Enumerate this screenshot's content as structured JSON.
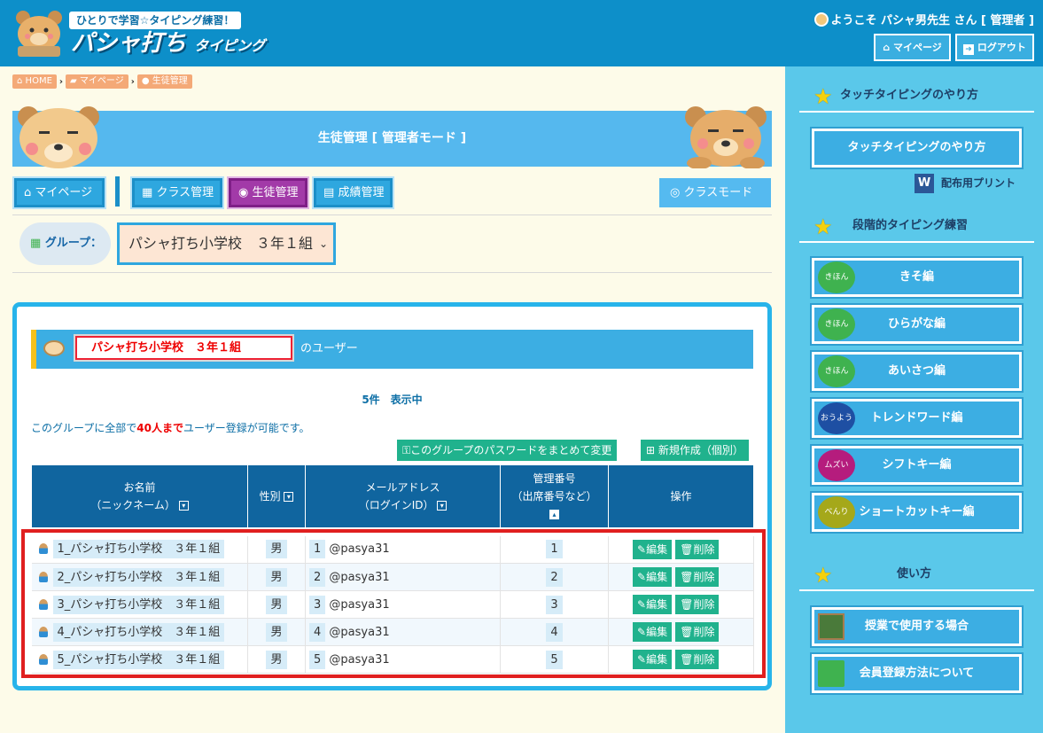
{
  "header": {
    "logo_sub": "ひとりで学習☆タイピング練習！",
    "logo_main": "パシャ打ち",
    "logo_main_small": "タイピング",
    "welcome": "ようこそ パシャ男先生 さん [ 管理者 ]",
    "mypage_label": "マイページ",
    "logout_label": "ログアウト"
  },
  "breadcrumb": {
    "home": "HOME",
    "mypage": "マイページ",
    "current": "生徒管理"
  },
  "banner": {
    "title": "生徒管理 [ 管理者モード ]"
  },
  "nav": {
    "mypage": "マイページ",
    "class": "クラス管理",
    "student": "生徒管理",
    "grades": "成績管理",
    "class_mode": "クラスモード"
  },
  "group": {
    "label": "グループ：",
    "selected": "パシャ打ち小学校　３年１組"
  },
  "panel": {
    "group_name": "パシャ打ち小学校　３年１組",
    "suffix": "のユーザー",
    "count": "5件　表示中",
    "limit_prefix": "このグループに全部で",
    "limit_emph": "40人まで",
    "limit_suffix": "ユーザー登録が可能です。",
    "btn_password": "このグループのパスワードをまとめて変更",
    "btn_new": "新規作成（個別）"
  },
  "table": {
    "col_name_1": "お名前",
    "col_name_2": "（ニックネーム）",
    "col_gender": "性別",
    "col_email_1": "メールアドレス",
    "col_email_2": "（ログインID）",
    "col_num_1": "管理番号",
    "col_num_2": "（出席番号など）",
    "col_op": "操作",
    "edit_label": "編集",
    "delete_label": "削除",
    "rows": [
      {
        "name": "1_パシャ打ち小学校　３年１組",
        "gender": "男",
        "id": "1",
        "email": "@pasya31",
        "num": "1"
      },
      {
        "name": "2_パシャ打ち小学校　３年１組",
        "gender": "男",
        "id": "2",
        "email": "@pasya31",
        "num": "2"
      },
      {
        "name": "3_パシャ打ち小学校　３年１組",
        "gender": "男",
        "id": "3",
        "email": "@pasya31",
        "num": "3"
      },
      {
        "name": "4_パシャ打ち小学校　３年１組",
        "gender": "男",
        "id": "4",
        "email": "@pasya31",
        "num": "4"
      },
      {
        "name": "5_パシャ打ち小学校　３年１組",
        "gender": "男",
        "id": "5",
        "email": "@pasya31",
        "num": "5"
      }
    ]
  },
  "sidebar": {
    "sec1": "タッチタイピングのやり方",
    "touch_btn": "タッチタイピングのやり方",
    "print": "配布用プリント",
    "sec2": "段階的タイピング練習",
    "courses": [
      {
        "badge": "きほん",
        "label": "きそ編",
        "color": "#3fb24f"
      },
      {
        "badge": "きほん",
        "label": "ひらがな編",
        "color": "#3fb24f"
      },
      {
        "badge": "きほん",
        "label": "あいさつ編",
        "color": "#3fb24f"
      },
      {
        "badge": "おうよう",
        "label": "トレンドワード編",
        "color": "#1e4fa3"
      },
      {
        "badge": "ムズい",
        "label": "シフトキー編",
        "color": "#b51c7d"
      },
      {
        "badge": "べんり",
        "label": "ショートカットキー編",
        "color": "#a5a81a"
      }
    ],
    "sec3": "使い方",
    "use1": "授業で使用する場合",
    "use2": "会員登録方法について"
  },
  "colors": {
    "header": "#0d8fc9",
    "accent": "#2ea7df",
    "table_head": "#10659f",
    "action_green": "#20b28d",
    "highlight_red": "#e01f1f"
  }
}
